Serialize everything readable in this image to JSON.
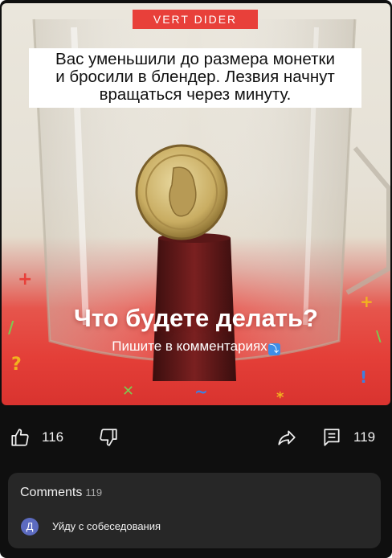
{
  "video": {
    "brand": "VERT DIDER",
    "caption_lines": [
      "Вас уменьшили до размера монетки",
      "и бросили в блендер. Лезвия начнут",
      "вращаться через минуту."
    ],
    "question": "Что будете делать?",
    "subtitle": "Пишите в комментариях",
    "subtitle_emoji": "arrow-down-emoji",
    "colors": {
      "brand_red": "#e8403a",
      "overlay_red": "#e43f38"
    }
  },
  "actions": {
    "likes": "116",
    "comments": "119",
    "icons": [
      "thumbs-up-icon",
      "thumbs-down-icon",
      "share-icon",
      "comment-icon"
    ]
  },
  "comments_panel": {
    "title": "Comments",
    "count": "119",
    "top_comment": {
      "avatar_letter": "Д",
      "text": "Уйду с собеседования"
    }
  }
}
